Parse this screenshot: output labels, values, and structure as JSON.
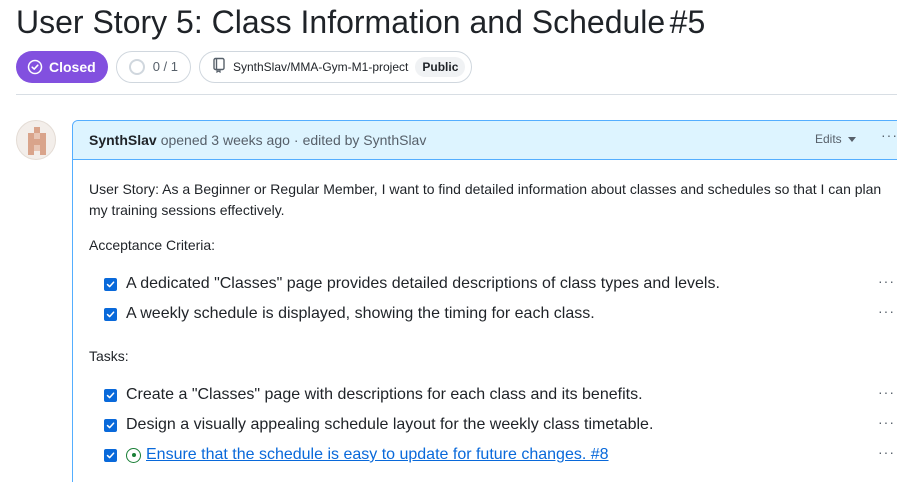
{
  "issue": {
    "title": "User Story 5: Class Information and Schedule",
    "number": "#5",
    "state_label": "Closed",
    "subtasks_progress": "0 / 1",
    "repo": "SynthSlav/MMA-Gym-M1-project",
    "visibility": "Public"
  },
  "comment": {
    "author": "SynthSlav",
    "opened_text": "opened 3 weeks ago",
    "separator": "·",
    "edited_text": "edited by SynthSlav",
    "edits_label": "Edits",
    "more_label": "···",
    "user_story": "User Story: As a Beginner or Regular Member, I want to find detailed information about classes and schedules so that I can plan my training sessions effectively.",
    "acceptance_label": "Acceptance Criteria:",
    "acceptance_items": [
      {
        "text": "A dedicated \"Classes\" page provides detailed descriptions of class types and levels.",
        "checked": true
      },
      {
        "text": "A weekly schedule is displayed, showing the timing for each class.",
        "checked": true
      }
    ],
    "tasks_label": "Tasks:",
    "task_items": [
      {
        "text": "Create a \"Classes\" page with descriptions for each class and its benefits.",
        "checked": true
      },
      {
        "text": "Design a visually appealing schedule layout for the weekly class timetable.",
        "checked": true
      },
      {
        "text": "Ensure that the schedule is easy to update for future changes. #8",
        "checked": true,
        "linked_issue_state": "open"
      }
    ]
  },
  "colors": {
    "closed_badge": "#8250df",
    "accent_blue": "#0969da",
    "header_bg": "#ddf4ff",
    "open_green": "#1a7f37"
  },
  "icons": {
    "state": "check-circle-icon",
    "progress": "circle-outline-icon",
    "repo": "repo-icon",
    "edits": "caret-down-icon",
    "more": "kebab-horizontal-icon",
    "issue_open": "issue-opened-icon",
    "checkbox": "checkbox-checked-icon"
  }
}
